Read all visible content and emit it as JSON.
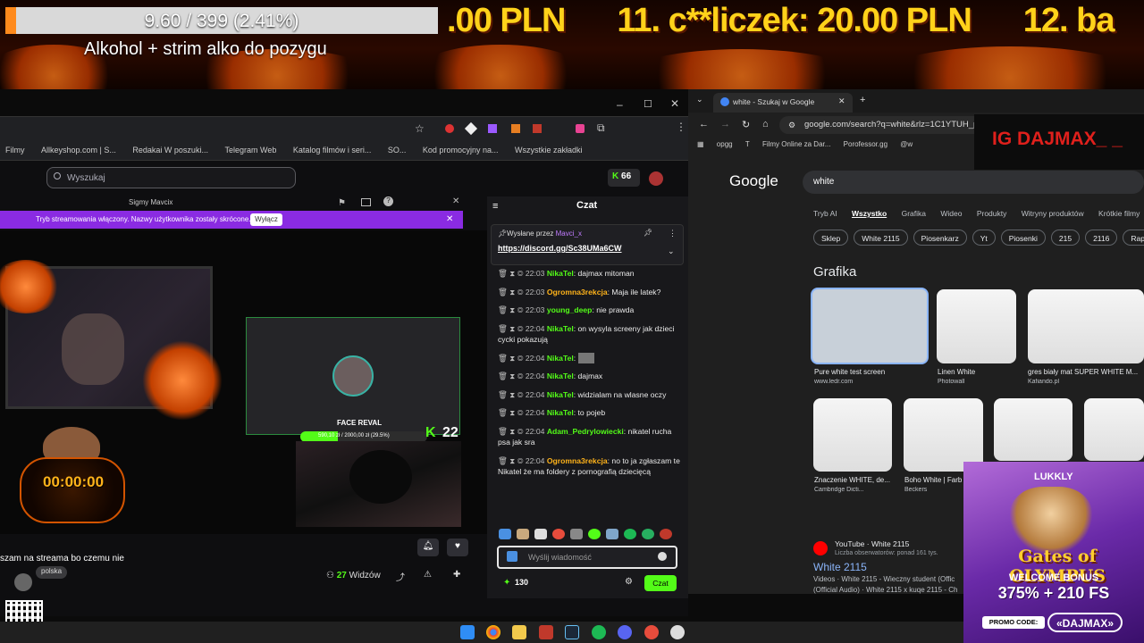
{
  "overlay": {
    "goal_text": "9.60 / 399 (2.41%)",
    "goal_fraction": 0.0241,
    "goal_subtitle": "Alkohol + strim alko do pozygu",
    "ticker": [
      ".00 PLN",
      "11. c**liczek: 20.00 PLN",
      "12. ba"
    ],
    "accent_color": "#ffd21a"
  },
  "left_browser": {
    "bookmarks": [
      "Filmy",
      "Allkeyshop.com | S...",
      "Redakai W poszuki...",
      "Telegram Web",
      "Katalog filmów i seri...",
      "SO...",
      "Kod promocyjny na...",
      "Wszystkie zakładki"
    ]
  },
  "kick": {
    "search_placeholder": "Wyszukaj",
    "points_badge": "66",
    "popout_title": "Sigmy Mavcix",
    "notice_text": "Tryb streamowania włączony. Nazwy użytkownika zostały skrócone.",
    "notice_button": "Wyłącz",
    "face_reveal_label": "FACE REVAL",
    "kick_goal_text": "590,10 zł / 2000,00 zł (29.5%)",
    "kick_goal_fraction": 0.295,
    "kick_count": "22",
    "timer": "00:00:00",
    "stream_title": "szam na streama bo czemu nie",
    "tag": "polska",
    "viewers_count": "27",
    "viewers_label": "Widzów",
    "brand_color": "#53fc18"
  },
  "chat": {
    "title": "Czat",
    "pinned_by_label": "Wysłane przez",
    "pinned_by_user": "Mavci_x",
    "pinned_link": "https://discord.gg/Sc38UMa6CW",
    "messages": [
      {
        "time": "22:03",
        "user": "NikaTel",
        "color": "#53fc18",
        "text": "dajmax mitoman"
      },
      {
        "time": "22:03",
        "user": "Ogromna3rekcja",
        "color": "#ffb31a",
        "text": "Maja ile latek?"
      },
      {
        "time": "22:03",
        "user": "young_deep",
        "color": "#53fc18",
        "text": "nie prawda"
      },
      {
        "time": "22:04",
        "user": "NikaTel",
        "color": "#53fc18",
        "text": "on wysyla screeny jak dzieci cycki pokazują"
      },
      {
        "time": "22:04",
        "user": "NikaTel",
        "color": "#53fc18",
        "text": ""
      },
      {
        "time": "22:04",
        "user": "NikaTel",
        "color": "#53fc18",
        "text": "dajmax"
      },
      {
        "time": "22:04",
        "user": "NikaTel",
        "color": "#53fc18",
        "text": "widzialam na wlasne oczy"
      },
      {
        "time": "22:04",
        "user": "NikaTel",
        "color": "#53fc18",
        "text": "to pojeb"
      },
      {
        "time": "22:04",
        "user": "Adam_Pedrylowiecki",
        "color": "#53fc18",
        "text": "nikatel rucha psa jak sra"
      },
      {
        "time": "22:04",
        "user": "Ogromna3rekcja",
        "color": "#ffb31a",
        "text": "no to ja zgłaszam te Nikatel że ma foldery z pornografią dziecięcą"
      }
    ],
    "input_placeholder": "Wyślij wiadomość",
    "points": "130",
    "send_label": "Czat"
  },
  "right_browser": {
    "tab_title": "white - Szukaj w Google",
    "address": "google.com/search?q=white&rlz=1C1YTUH_p",
    "bookmarks": [
      "opgg",
      "T",
      "Filmy Online za Dar...",
      "Porofessor.gg",
      "@w"
    ],
    "ig_label": "IG DAJMAX_ _",
    "logo": "Google",
    "query": "white",
    "tabs": [
      "Tryb AI",
      "Wszystko",
      "Grafika",
      "Wideo",
      "Produkty",
      "Witryny produktów",
      "Krótkie filmy"
    ],
    "active_tab": "Wszystko",
    "chips": [
      "Sklep",
      "White 2115",
      "Piosenkarz",
      "Yt",
      "Piosenki",
      "215",
      "2116",
      "Rapper"
    ],
    "images_heading": "Grafika",
    "images": [
      {
        "caption": "Pure white test screen",
        "source": "www.ledr.com"
      },
      {
        "caption": "Linen White",
        "source": "Photowall"
      },
      {
        "caption": "gres biały mat SUPER WHITE M...",
        "source": "Kafiando.pl"
      },
      {
        "caption": "Znaczenie WHITE, de...",
        "source": "Cambridge Dicti..."
      },
      {
        "caption": "Boho White | Farb...",
        "source": "Beckers"
      }
    ],
    "yt_source": "YouTube · White 2115",
    "yt_sub": "Liczba obserwatorów: ponad 161 tys.",
    "yt_title": "White 2115",
    "yt_desc": [
      "Videos · White 2115 - Wieczny student (Offic",
      "(Official Audio) · White 2115 x kuqe 2115 - Ch"
    ]
  },
  "ad": {
    "brand": "LUKKLY",
    "game": "Gates of OLYMPUS",
    "bonus1": "WELCOME BONUS",
    "bonus2": "375% + 210 FS",
    "promo_label": "PROMO CODE:",
    "promo_code": "«DAJMAX»"
  }
}
